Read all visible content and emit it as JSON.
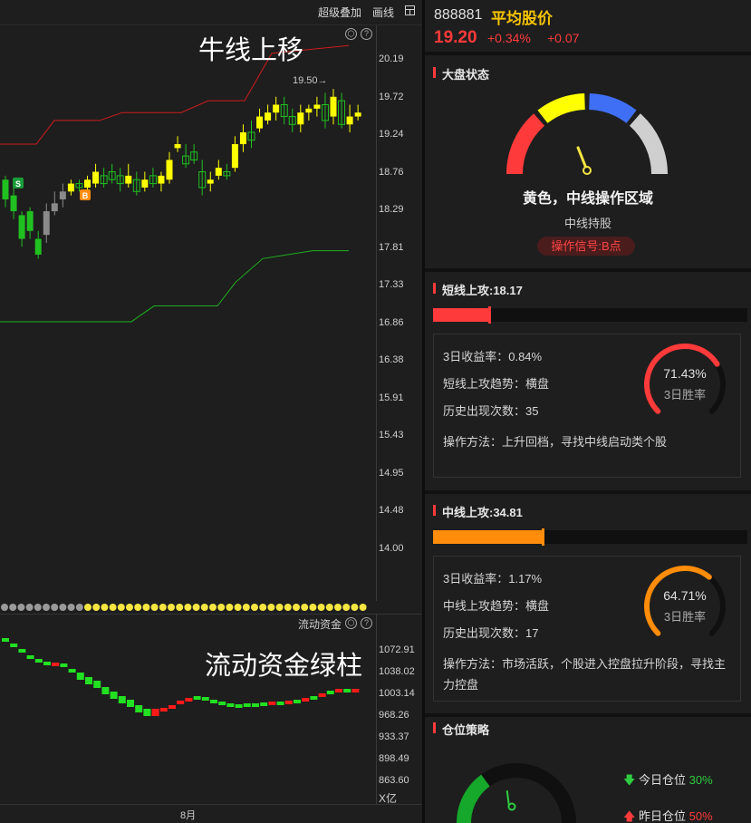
{
  "toolbar": {
    "overlay": "超级叠加",
    "draw": "画线"
  },
  "main_chart": {
    "title": "牛线上移",
    "y_ticks": [
      "20.19",
      "19.72",
      "19.24",
      "18.76",
      "18.29",
      "17.81",
      "17.33",
      "16.86",
      "16.38",
      "15.91",
      "15.43",
      "14.95",
      "14.48",
      "14.00"
    ],
    "peak_label": "19.50→",
    "buy_marker": "B",
    "sell_marker": "S"
  },
  "sub_chart": {
    "title": "流动资金绿柱",
    "label": "流动资金",
    "y_ticks": [
      "1072.91",
      "1038.02",
      "1003.14",
      "968.26",
      "933.37",
      "898.49",
      "863.60"
    ],
    "unit": "X亿"
  },
  "x_axis": {
    "month": "8月"
  },
  "stock": {
    "code": "888881",
    "name": "平均股价",
    "price": "19.20",
    "pct": "+0.34%",
    "change": "+0.07"
  },
  "market": {
    "title": "大盘状态",
    "status": "黄色，中线操作区域",
    "sub": "中线持股",
    "signal": "操作信号:B点",
    "gauge_colors": [
      "#ff3a3a",
      "#ffff00",
      "#3f6ff5",
      "#cfcfcf"
    ],
    "gauge_level": 0.38
  },
  "short_attack": {
    "title": "短线上攻:18.17",
    "progress": 0.18,
    "color": "#ff3a3a",
    "return_label": "3日收益率：",
    "return_value": "0.84%",
    "trend_label": "短线上攻趋势：",
    "trend_value": "横盘",
    "count_label": "历史出现次数：",
    "count_value": "35",
    "method": "操作方法：上升回档，寻找中线启动类个股",
    "win_rate": "71.43%",
    "win_label": "3日胜率",
    "win_fraction": 0.7143
  },
  "mid_attack": {
    "title": "中线上攻:34.81",
    "progress": 0.35,
    "color": "#ff8c0a",
    "return_label": "3日收益率：",
    "return_value": "1.17%",
    "trend_label": "中线上攻趋势：",
    "trend_value": "横盘",
    "count_label": "历史出现次数：",
    "count_value": "17",
    "method": "操作方法：市场活跃，个股进入控盘拉升阶段，寻找主力控盘",
    "win_rate": "64.71%",
    "win_label": "3日胜率",
    "win_fraction": 0.6471
  },
  "position": {
    "title": "仓位策略",
    "today_label": "今日仓位",
    "today_value": "30%",
    "yesterday_label": "昨日仓位",
    "yesterday_value": "50%",
    "level": 0.3
  },
  "colors": {
    "up": "#ffff00",
    "down": "#21c021",
    "red": "#ff3a3a",
    "bg": "#1e1e1e"
  }
}
